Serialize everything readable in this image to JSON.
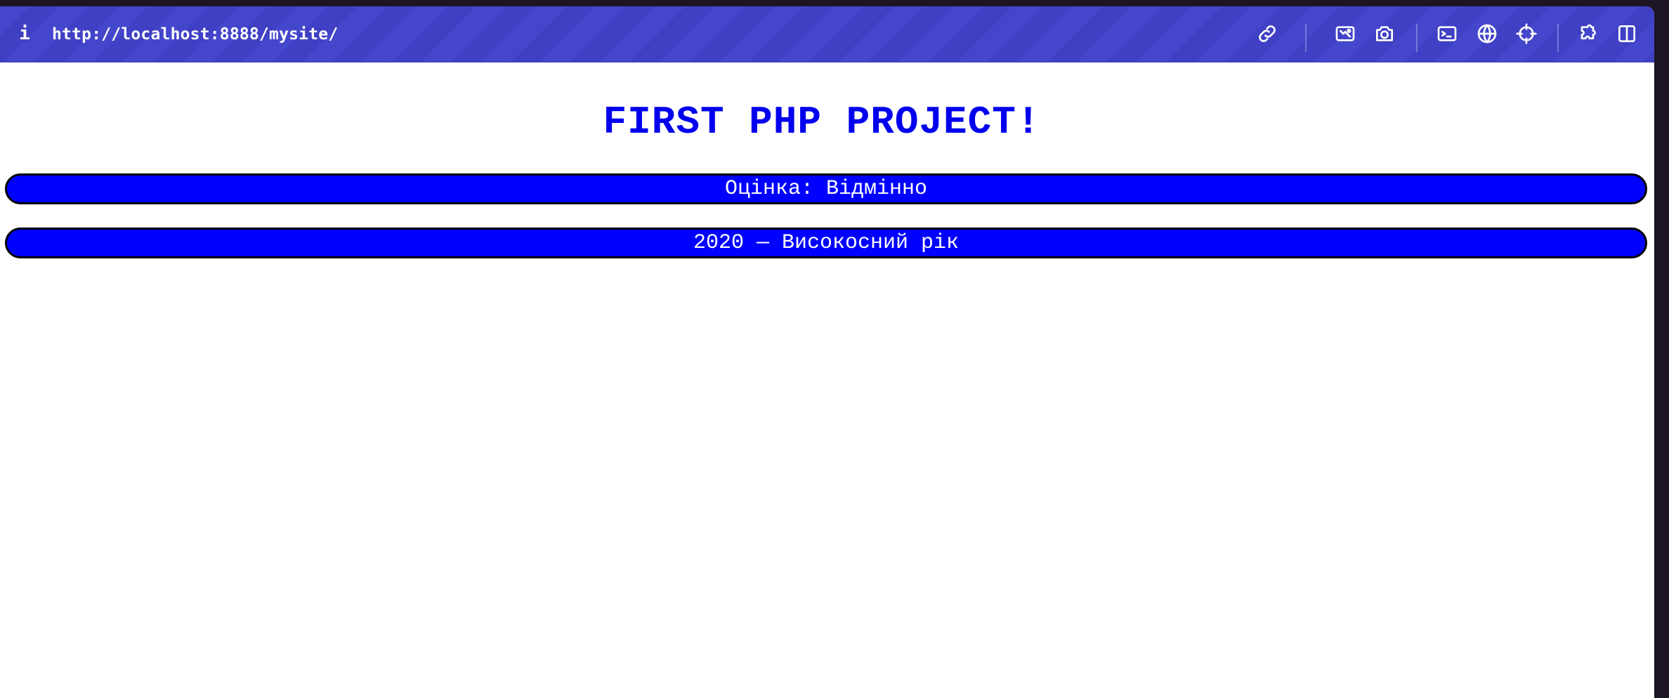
{
  "toolbar": {
    "info_symbol": "i",
    "url": "http://localhost:8888/mysite/",
    "icons": [
      "link-icon",
      "screenshot-area-icon",
      "camera-icon",
      "terminal-icon",
      "globe-icon",
      "crosshair-icon",
      "extensions-icon",
      "sidebar-icon"
    ],
    "background_color": "#4446cc"
  },
  "page": {
    "title": "FIRST PHP PROJECT!",
    "title_color": "#0000ee",
    "bars": [
      {
        "text": "Оцінка: Відмінно"
      },
      {
        "text": "2020 — Високосний рік"
      }
    ],
    "bar_color": "#0000ff"
  }
}
